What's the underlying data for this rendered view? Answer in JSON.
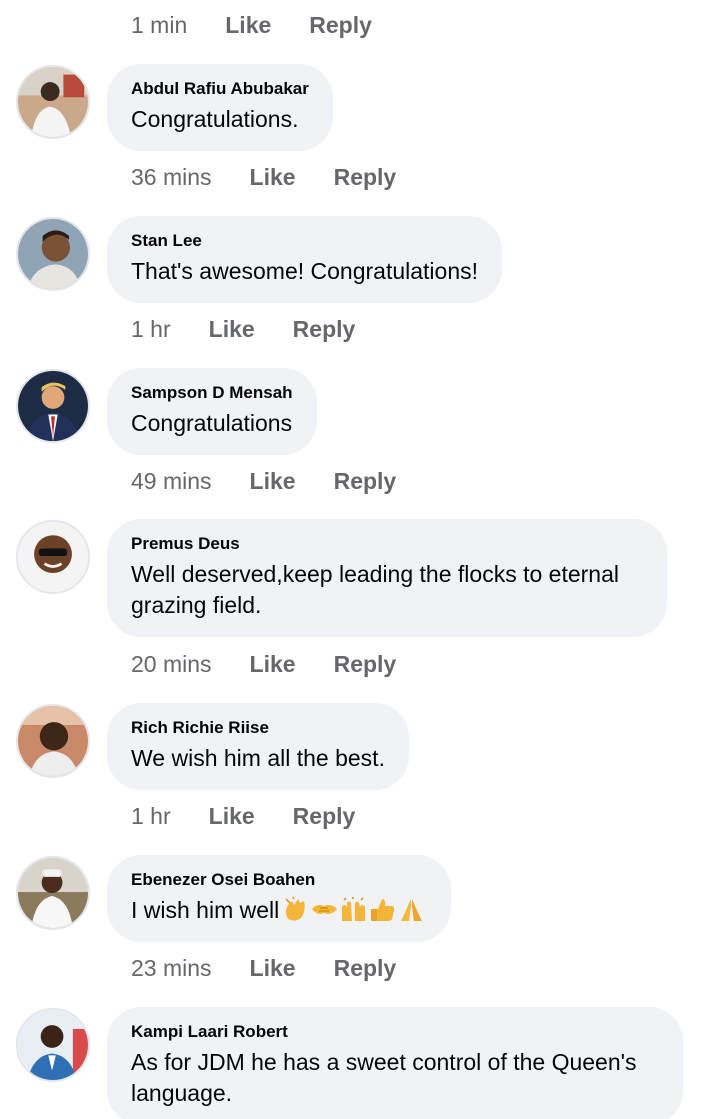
{
  "actions": {
    "like": "Like",
    "reply": "Reply"
  },
  "top_meta": {
    "time": "1 min"
  },
  "comments": [
    {
      "author": "Abdul Rafiu Abubakar",
      "text": "Congratulations.",
      "time": "36 mins"
    },
    {
      "author": "Stan Lee",
      "text": "That's awesome! Congratulations!",
      "time": "1 hr"
    },
    {
      "author": "Sampson D Mensah",
      "text": "Congratulations",
      "time": "49 mins"
    },
    {
      "author": "Premus Deus",
      "text": "Well deserved,keep leading the flocks to eternal grazing field.",
      "time": "20 mins"
    },
    {
      "author": "Rich Richie Riise",
      "text": "We wish him all the best.",
      "time": "1 hr"
    },
    {
      "author": "Ebenezer Osei Boahen",
      "text": "I wish him well",
      "emojis": [
        "clapping-hands",
        "handshake",
        "raising-hands",
        "thumbs-up",
        "folded-hands"
      ],
      "time": "23 mins"
    },
    {
      "author": "Kampi Laari Robert",
      "text": "As for JDM he has a sweet control of the Queen's language."
    }
  ],
  "colors": {
    "bubble": "#f0f2f5",
    "meta_text": "#65676b",
    "body_text": "#050505"
  }
}
